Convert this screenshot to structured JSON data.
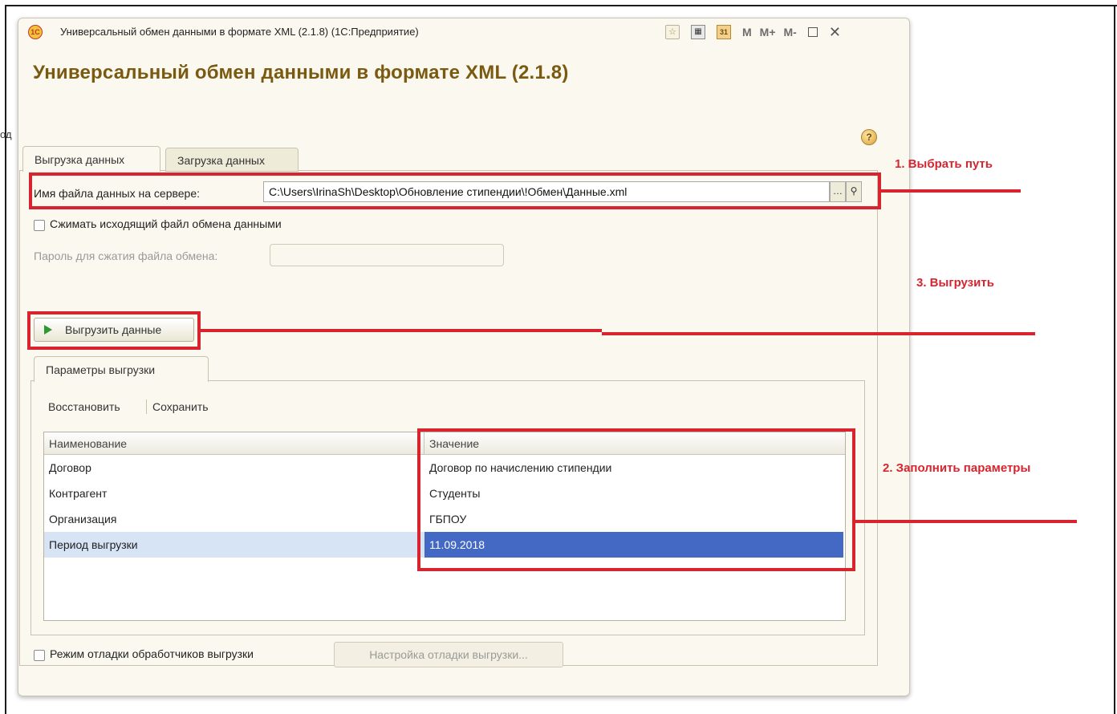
{
  "window": {
    "title": "Универсальный обмен данными в формате XML (2.1.8)  (1С:Предприятие)",
    "toolbar": {
      "m_label": "M",
      "mplus_label": "M+",
      "mminus_label": "M-",
      "close_glyph": "✕"
    }
  },
  "stray_text": "од",
  "form": {
    "title": "Универсальный обмен данными в формате XML (2.1.8)",
    "help_glyph": "?"
  },
  "tabs": [
    {
      "label": "Выгрузка данных",
      "active": true
    },
    {
      "label": "Загрузка данных",
      "active": false
    }
  ],
  "export": {
    "file_label": "Имя файла данных на сервере:",
    "file_value": "C:\\Users\\IrinaSh\\Desktop\\Обновление стипендии\\!Обмен\\Данные.xml",
    "compress_label": "Сжимать исходящий файл обмена данными",
    "password_label": "Пароль для сжатия файла обмена:",
    "export_button": "Выгрузить данные",
    "params_tab": "Параметры выгрузки",
    "restore": "Восстановить",
    "save": "Сохранить",
    "table": {
      "headers": [
        "Наименование",
        "Значение"
      ],
      "rows": [
        {
          "name": "Договор",
          "value": "Договор по начислению стипендии"
        },
        {
          "name": "Контрагент",
          "value": "Студенты"
        },
        {
          "name": "Организация",
          "value": "ГБПОУ"
        },
        {
          "name": "Период выгрузки",
          "value": "11.09.2018"
        }
      ]
    },
    "debug_label": "Режим отладки обработчиков выгрузки",
    "debug_button": "Настройка отладки выгрузки..."
  },
  "annotations": {
    "step1": "1. Выбрать путь",
    "step2": "2. Заполнить параметры",
    "step3": "3. Выгрузить"
  },
  "colors": {
    "annotation_red": "#d7242f",
    "title_brown": "#7a5a10",
    "selection_blue": "#4469c4"
  }
}
